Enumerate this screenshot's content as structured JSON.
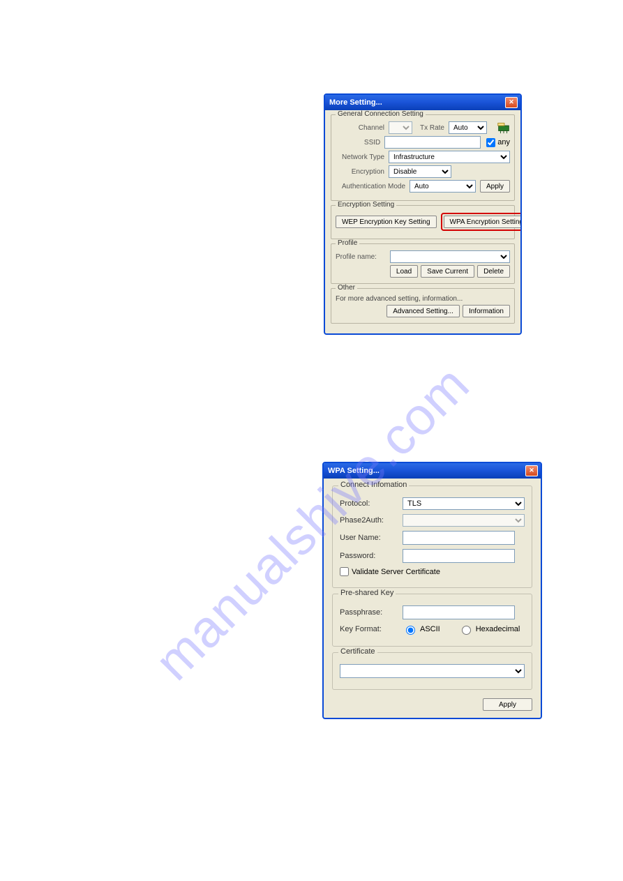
{
  "watermark": "manualshive.com",
  "window1": {
    "title": "More Setting...",
    "group_general": "General Connection Setting",
    "channel_label": "Channel",
    "channel_value": "",
    "txrate_label": "Tx Rate",
    "txrate_value": "Auto",
    "ssid_label": "SSID",
    "ssid_value": "",
    "any_label": "any",
    "nettype_label": "Network Type",
    "nettype_value": "Infrastructure",
    "enc_label": "Encryption",
    "enc_value": "Disable",
    "auth_label": "Authentication Mode",
    "auth_value": "Auto",
    "apply_btn": "Apply",
    "group_enc": "Encryption Setting",
    "wep_btn": "WEP Encryption Key Setting",
    "wpa_btn": "WPA Encryption Setting",
    "group_profile": "Profile",
    "profile_name_label": "Profile name:",
    "load_btn": "Load",
    "save_btn": "Save Current",
    "delete_btn": "Delete",
    "group_other": "Other",
    "other_text": "For more advanced setting, information...",
    "adv_btn": "Advanced Setting...",
    "info_btn": "Information"
  },
  "window2": {
    "title": "WPA Setting...",
    "group_conn": "Connect Infomation",
    "protocol_label": "Protocol:",
    "protocol_value": "TLS",
    "phase2_label": "Phase2Auth:",
    "user_label": "User Name:",
    "pass_label": "Password:",
    "validate_label": "Validate Server Certificate",
    "group_psk": "Pre-shared Key",
    "passphrase_label": "Passphrase:",
    "keyfmt_label": "Key Format:",
    "ascii_label": "ASCII",
    "hex_label": "Hexadecimal",
    "group_cert": "Certificate",
    "apply_btn": "Apply"
  }
}
